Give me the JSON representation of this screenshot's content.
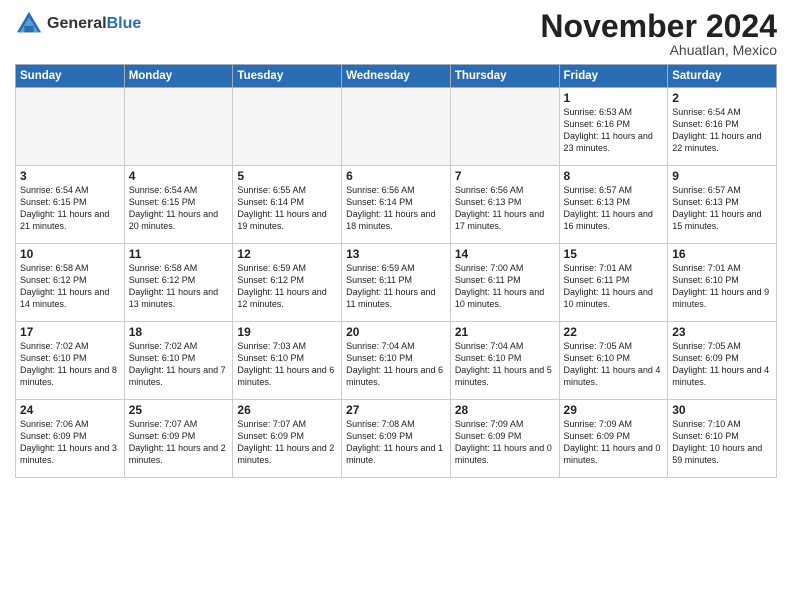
{
  "header": {
    "logo_general": "General",
    "logo_blue": "Blue",
    "month_title": "November 2024",
    "location": "Ahuatlan, Mexico"
  },
  "weekdays": [
    "Sunday",
    "Monday",
    "Tuesday",
    "Wednesday",
    "Thursday",
    "Friday",
    "Saturday"
  ],
  "weeks": [
    [
      {
        "day": "",
        "info": ""
      },
      {
        "day": "",
        "info": ""
      },
      {
        "day": "",
        "info": ""
      },
      {
        "day": "",
        "info": ""
      },
      {
        "day": "",
        "info": ""
      },
      {
        "day": "1",
        "info": "Sunrise: 6:53 AM\nSunset: 6:16 PM\nDaylight: 11 hours\nand 23 minutes."
      },
      {
        "day": "2",
        "info": "Sunrise: 6:54 AM\nSunset: 6:16 PM\nDaylight: 11 hours\nand 22 minutes."
      }
    ],
    [
      {
        "day": "3",
        "info": "Sunrise: 6:54 AM\nSunset: 6:15 PM\nDaylight: 11 hours\nand 21 minutes."
      },
      {
        "day": "4",
        "info": "Sunrise: 6:54 AM\nSunset: 6:15 PM\nDaylight: 11 hours\nand 20 minutes."
      },
      {
        "day": "5",
        "info": "Sunrise: 6:55 AM\nSunset: 6:14 PM\nDaylight: 11 hours\nand 19 minutes."
      },
      {
        "day": "6",
        "info": "Sunrise: 6:56 AM\nSunset: 6:14 PM\nDaylight: 11 hours\nand 18 minutes."
      },
      {
        "day": "7",
        "info": "Sunrise: 6:56 AM\nSunset: 6:13 PM\nDaylight: 11 hours\nand 17 minutes."
      },
      {
        "day": "8",
        "info": "Sunrise: 6:57 AM\nSunset: 6:13 PM\nDaylight: 11 hours\nand 16 minutes."
      },
      {
        "day": "9",
        "info": "Sunrise: 6:57 AM\nSunset: 6:13 PM\nDaylight: 11 hours\nand 15 minutes."
      }
    ],
    [
      {
        "day": "10",
        "info": "Sunrise: 6:58 AM\nSunset: 6:12 PM\nDaylight: 11 hours\nand 14 minutes."
      },
      {
        "day": "11",
        "info": "Sunrise: 6:58 AM\nSunset: 6:12 PM\nDaylight: 11 hours\nand 13 minutes."
      },
      {
        "day": "12",
        "info": "Sunrise: 6:59 AM\nSunset: 6:12 PM\nDaylight: 11 hours\nand 12 minutes."
      },
      {
        "day": "13",
        "info": "Sunrise: 6:59 AM\nSunset: 6:11 PM\nDaylight: 11 hours\nand 11 minutes."
      },
      {
        "day": "14",
        "info": "Sunrise: 7:00 AM\nSunset: 6:11 PM\nDaylight: 11 hours\nand 10 minutes."
      },
      {
        "day": "15",
        "info": "Sunrise: 7:01 AM\nSunset: 6:11 PM\nDaylight: 11 hours\nand 10 minutes."
      },
      {
        "day": "16",
        "info": "Sunrise: 7:01 AM\nSunset: 6:10 PM\nDaylight: 11 hours\nand 9 minutes."
      }
    ],
    [
      {
        "day": "17",
        "info": "Sunrise: 7:02 AM\nSunset: 6:10 PM\nDaylight: 11 hours\nand 8 minutes."
      },
      {
        "day": "18",
        "info": "Sunrise: 7:02 AM\nSunset: 6:10 PM\nDaylight: 11 hours\nand 7 minutes."
      },
      {
        "day": "19",
        "info": "Sunrise: 7:03 AM\nSunset: 6:10 PM\nDaylight: 11 hours\nand 6 minutes."
      },
      {
        "day": "20",
        "info": "Sunrise: 7:04 AM\nSunset: 6:10 PM\nDaylight: 11 hours\nand 6 minutes."
      },
      {
        "day": "21",
        "info": "Sunrise: 7:04 AM\nSunset: 6:10 PM\nDaylight: 11 hours\nand 5 minutes."
      },
      {
        "day": "22",
        "info": "Sunrise: 7:05 AM\nSunset: 6:10 PM\nDaylight: 11 hours\nand 4 minutes."
      },
      {
        "day": "23",
        "info": "Sunrise: 7:05 AM\nSunset: 6:09 PM\nDaylight: 11 hours\nand 4 minutes."
      }
    ],
    [
      {
        "day": "24",
        "info": "Sunrise: 7:06 AM\nSunset: 6:09 PM\nDaylight: 11 hours\nand 3 minutes."
      },
      {
        "day": "25",
        "info": "Sunrise: 7:07 AM\nSunset: 6:09 PM\nDaylight: 11 hours\nand 2 minutes."
      },
      {
        "day": "26",
        "info": "Sunrise: 7:07 AM\nSunset: 6:09 PM\nDaylight: 11 hours\nand 2 minutes."
      },
      {
        "day": "27",
        "info": "Sunrise: 7:08 AM\nSunset: 6:09 PM\nDaylight: 11 hours\nand 1 minute."
      },
      {
        "day": "28",
        "info": "Sunrise: 7:09 AM\nSunset: 6:09 PM\nDaylight: 11 hours\nand 0 minutes."
      },
      {
        "day": "29",
        "info": "Sunrise: 7:09 AM\nSunset: 6:09 PM\nDaylight: 11 hours\nand 0 minutes."
      },
      {
        "day": "30",
        "info": "Sunrise: 7:10 AM\nSunset: 6:10 PM\nDaylight: 10 hours\nand 59 minutes."
      }
    ]
  ]
}
